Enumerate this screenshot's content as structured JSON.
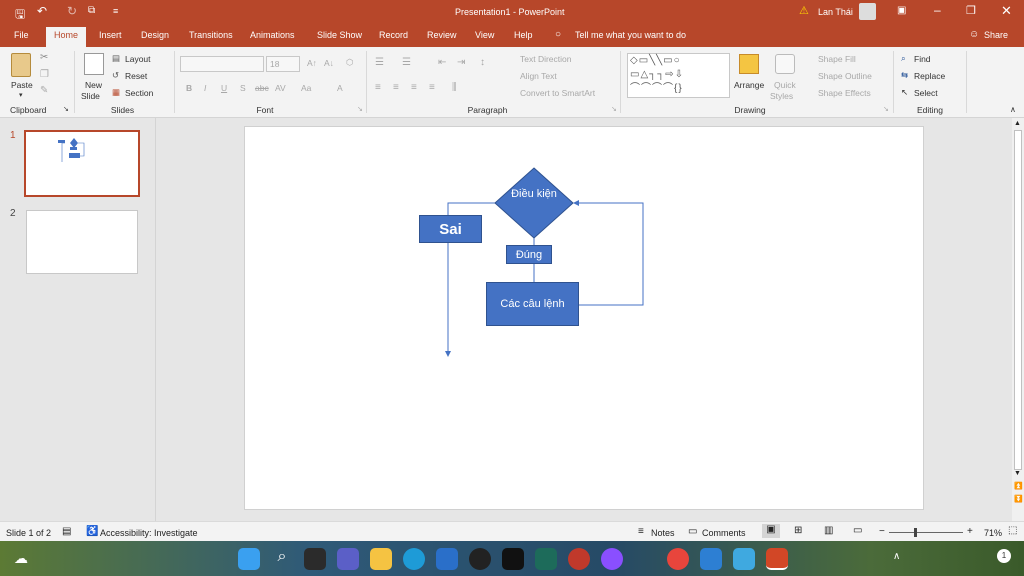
{
  "app": {
    "title": "Presentation1 - PowerPoint",
    "user": "Lan Thái",
    "tell_me": "Tell me what you want to do",
    "share": "Share"
  },
  "tabs": [
    "File",
    "Home",
    "Insert",
    "Design",
    "Transitions",
    "Animations",
    "Slide Show",
    "Record",
    "Review",
    "View",
    "Help"
  ],
  "ribbon": {
    "clipboard": {
      "paste": "Paste",
      "label": "Clipboard"
    },
    "slides": {
      "new_slide_1": "New",
      "new_slide_2": "Slide",
      "layout": "Layout",
      "reset": "Reset",
      "section": "Section",
      "label": "Slides"
    },
    "font": {
      "size": "18",
      "label": "Font",
      "bold": "B",
      "italic": "I",
      "underline": "U",
      "shadow": "S",
      "strike": "abc",
      "spacing": "AV",
      "case": "Aa"
    },
    "paragraph": {
      "text_direction": "Text Direction",
      "align_text": "Align Text",
      "convert": "Convert to SmartArt",
      "label": "Paragraph"
    },
    "drawing": {
      "arrange": "Arrange",
      "quick_styles_1": "Quick",
      "quick_styles_2": "Styles",
      "shape_fill": "Shape Fill",
      "shape_outline": "Shape Outline",
      "shape_effects": "Shape Effects",
      "label": "Drawing"
    },
    "editing": {
      "find": "Find",
      "replace": "Replace",
      "select": "Select",
      "label": "Editing"
    }
  },
  "thumbnails": [
    {
      "num": "1"
    },
    {
      "num": "2"
    }
  ],
  "flowchart": {
    "diamond": "Điều kiện",
    "false_box": "Sai",
    "true_label": "Đúng",
    "statements": "Các câu lệnh"
  },
  "status": {
    "slide": "Slide 1 of 2",
    "accessibility": "Accessibility: Investigate",
    "notes": "Notes",
    "comments": "Comments",
    "zoom": "71%"
  },
  "colors": {
    "accent": "#b7472a",
    "shape": "#4472c4",
    "connector": "#4472c4"
  }
}
